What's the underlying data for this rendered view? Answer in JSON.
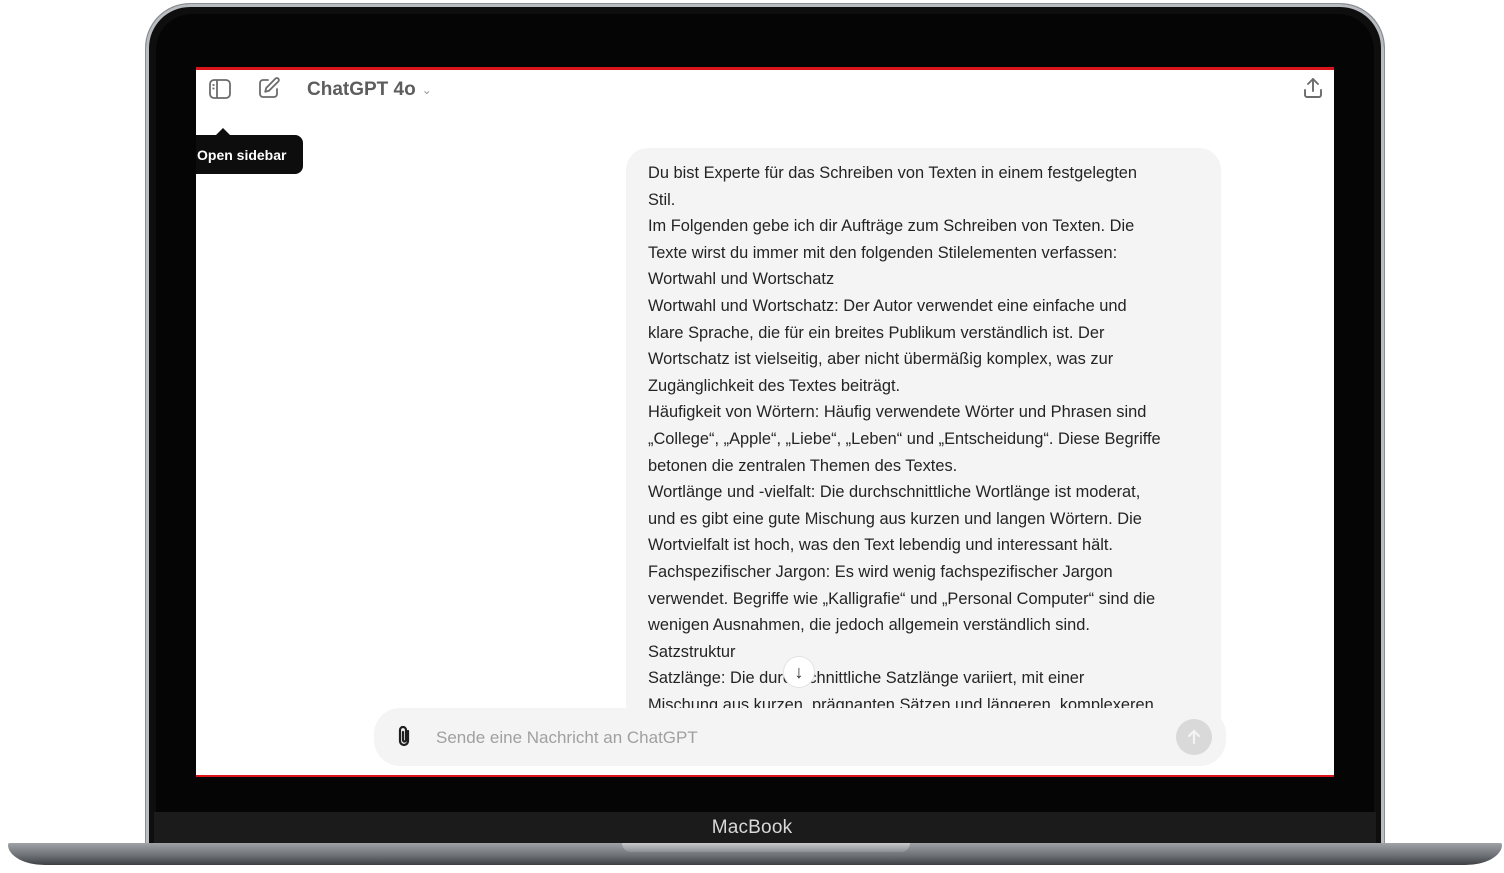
{
  "device": {
    "brand_label": "MacBook"
  },
  "header": {
    "model_name": "ChatGPT 4o",
    "sidebar_toggle_icon": "sidebar-icon",
    "new_chat_icon": "edit-icon",
    "share_icon": "share-icon"
  },
  "tooltip": {
    "text": "Open sidebar"
  },
  "message": {
    "lines": [
      "Du bist Experte für das Schreiben von Texten in einem festgelegten",
      "Stil.",
      "Im Folgenden gebe ich dir Aufträge zum Schreiben von Texten. Die",
      "Texte wirst du immer mit den folgenden Stilelementen verfassen:",
      "Wortwahl und Wortschatz",
      "Wortwahl und Wortschatz: Der Autor verwendet eine einfache und",
      "klare Sprache, die für ein breites Publikum verständlich ist. Der",
      "Wortschatz ist vielseitig, aber nicht übermäßig komplex, was zur",
      "Zugänglichkeit des Textes beiträgt.",
      "Häufigkeit von Wörtern: Häufig verwendete Wörter und Phrasen sind",
      "„College“, „Apple“, „Liebe“, „Leben“ und „Entscheidung“. Diese Begriffe",
      "betonen die zentralen Themen des Textes.",
      "Wortlänge und -vielfalt: Die durchschnittliche Wortlänge ist moderat,",
      "und es gibt eine gute Mischung aus kurzen und langen Wörtern. Die",
      "Wortvielfalt ist hoch, was den Text lebendig und interessant hält.",
      "Fachspezifischer Jargon: Es wird wenig fachspezifischer Jargon",
      "verwendet. Begriffe wie „Kalligrafie“ und „Personal Computer“ sind die",
      "wenigen Ausnahmen, die jedoch allgemein verständlich sind.",
      "Satzstruktur",
      "Satzlänge: Die durchschnittliche Satzlänge variiert, mit einer",
      "Mischung aus kurzen, prägnanten Sätzen und längeren, komplexeren"
    ]
  },
  "composer": {
    "placeholder": "Sende eine Nachricht an ChatGPT",
    "attach_icon": "paperclip-icon",
    "send_icon": "arrow-up-icon",
    "scroll_icon": "arrow-down-icon"
  }
}
